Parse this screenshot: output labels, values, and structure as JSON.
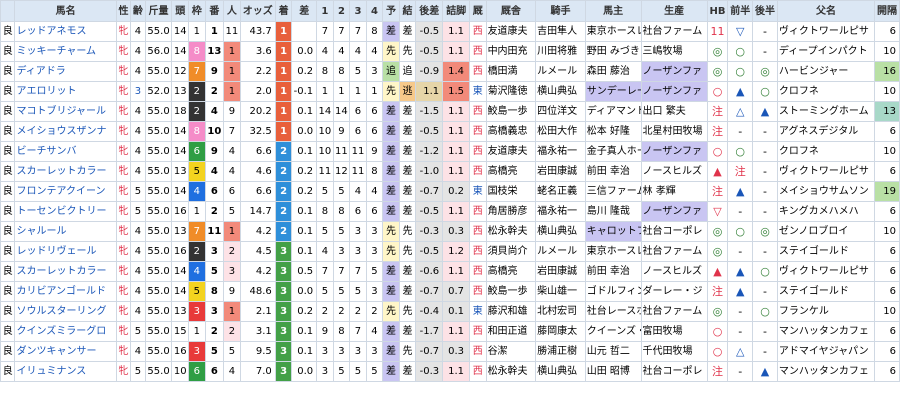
{
  "headers": [
    "",
    "馬名",
    "性",
    "齢",
    "斤量",
    "頭",
    "枠",
    "番",
    "人",
    "オッズ",
    "着",
    "差",
    "1",
    "2",
    "3",
    "4",
    "予",
    "結",
    "後差",
    "詰脚",
    "厩",
    "厩舎",
    "騎手",
    "馬主",
    "生産",
    "HB",
    "前半",
    "後半",
    "父名",
    "開隔"
  ],
  "rows": [
    [
      "良",
      "レッドアネモス",
      "牝",
      "4",
      "55.0",
      "14",
      "1",
      "1",
      "11",
      "43.7",
      "1",
      "",
      "7",
      "7",
      "7",
      "8",
      "差",
      "差",
      "-0.5",
      "1.1",
      "西",
      "友道康夫",
      "吉田隼人",
      "東京ホースレ",
      "社台ファーム",
      "11",
      "▽",
      "-",
      "ヴィクトワールピサ",
      "6"
    ],
    [
      "良",
      "ミッキーチャーム",
      "牝",
      "4",
      "56.0",
      "14",
      "8",
      "13",
      "1",
      "3.6",
      "1",
      "0.0",
      "4",
      "4",
      "4",
      "4",
      "先",
      "先",
      "-0.5",
      "1.1",
      "西",
      "中内田充",
      "川田将雅",
      "野田 みづき",
      "三嶋牧場",
      "◎",
      "○",
      "-",
      "ディープインパクト",
      "10"
    ],
    [
      "良",
      "ディアドラ",
      "牝",
      "4",
      "55.0",
      "12",
      "7",
      "9",
      "1",
      "2.2",
      "1",
      "0.2",
      "8",
      "8",
      "5",
      "3",
      "追",
      "追",
      "-0.9",
      "1.4",
      "西",
      "橋田満",
      "ルメール",
      "森田 藤治",
      "ノーザンファ",
      "◎",
      "○",
      "◎",
      "ハービンジャー",
      "16"
    ],
    [
      "良",
      "アエロリット",
      "牝",
      "3",
      "52.0",
      "13",
      "2",
      "2",
      "1",
      "2.0",
      "1",
      "-0.1",
      "1",
      "1",
      "1",
      "1",
      "先",
      "逃",
      "1.1",
      "1.5",
      "東",
      "菊沢隆徳",
      "横山典弘",
      "サンデーレー",
      "ノーザンファ",
      "○",
      "▲",
      "○",
      "クロフネ",
      "10"
    ],
    [
      "良",
      "マコトブリジャール",
      "牝",
      "4",
      "55.0",
      "18",
      "2",
      "4",
      "9",
      "20.2",
      "1",
      "0.1",
      "14",
      "14",
      "6",
      "6",
      "差",
      "差",
      "-1.5",
      "1.1",
      "西",
      "鮫島一歩",
      "四位洋文",
      "ディアマント",
      "出口 繁夫",
      "注",
      "△",
      "▲",
      "ストーミングホーム",
      "13"
    ],
    [
      "良",
      "メイショウスザンナ",
      "牝",
      "4",
      "55.0",
      "14",
      "8",
      "10",
      "7",
      "32.5",
      "1",
      "0.0",
      "10",
      "9",
      "6",
      "6",
      "差",
      "差",
      "-0.5",
      "1.1",
      "西",
      "高橋義忠",
      "松田大作",
      "松本 好隆",
      "北星村田牧場",
      "注",
      "-",
      "-",
      "アグネスデジタル",
      "6"
    ],
    [
      "良",
      "ビーチサンバ",
      "牝",
      "4",
      "55.0",
      "14",
      "6",
      "9",
      "4",
      "6.6",
      "2",
      "0.1",
      "10",
      "11",
      "11",
      "9",
      "差",
      "差",
      "-1.2",
      "1.1",
      "西",
      "友道康夫",
      "福永祐一",
      "金子真人ホー",
      "ノーザンファ",
      "○",
      "○",
      "-",
      "クロフネ",
      "10"
    ],
    [
      "良",
      "スカーレットカラー",
      "牝",
      "4",
      "55.0",
      "13",
      "5",
      "4",
      "4",
      "4.6",
      "2",
      "0.2",
      "11",
      "12",
      "11",
      "8",
      "差",
      "差",
      "-1.0",
      "1.1",
      "西",
      "高橋亮",
      "岩田康誠",
      "前田 幸治",
      "ノースヒルズ",
      "▲",
      "注",
      "-",
      "ヴィクトワールピサ",
      "6"
    ],
    [
      "良",
      "フロンテアクイーン",
      "牝",
      "5",
      "55.0",
      "14",
      "4",
      "6",
      "6",
      "6.6",
      "2",
      "0.2",
      "5",
      "5",
      "4",
      "4",
      "差",
      "差",
      "-0.7",
      "0.2",
      "東",
      "国枝栄",
      "蛯名正義",
      "三信ファーム",
      "林 孝輝",
      "注",
      "▲",
      "-",
      "メイショウサムソン",
      "19"
    ],
    [
      "良",
      "トーセンビクトリー",
      "牝",
      "5",
      "55.0",
      "16",
      "1",
      "2",
      "5",
      "14.7",
      "2",
      "0.1",
      "8",
      "8",
      "6",
      "6",
      "差",
      "差",
      "-0.5",
      "1.1",
      "西",
      "角居勝彦",
      "福永祐一",
      "島川 隆哉",
      "ノーザンファ",
      "▽",
      "-",
      "-",
      "キングカメハメハ",
      "6"
    ],
    [
      "良",
      "シャルール",
      "牝",
      "4",
      "55.0",
      "13",
      "7",
      "11",
      "1",
      "4.2",
      "2",
      "0.1",
      "5",
      "5",
      "3",
      "3",
      "先",
      "先",
      "-0.3",
      "0.3",
      "西",
      "松永幹夫",
      "横山典弘",
      "キャロットフ",
      "社台コーポレ",
      "◎",
      "○",
      "◎",
      "ゼンノロブロイ",
      "10"
    ],
    [
      "良",
      "レッドリヴェール",
      "牝",
      "4",
      "55.0",
      "16",
      "2",
      "3",
      "2",
      "4.5",
      "3",
      "0.1",
      "4",
      "3",
      "3",
      "3",
      "先",
      "先",
      "-0.5",
      "1.2",
      "西",
      "須貝尚介",
      "ルメール",
      "東京ホースレ",
      "社台ファーム",
      "◎",
      "-",
      "-",
      "ステイゴールド",
      "6"
    ],
    [
      "良",
      "スカーレットカラー",
      "牝",
      "4",
      "55.0",
      "14",
      "4",
      "5",
      "3",
      "4.2",
      "3",
      "0.5",
      "7",
      "7",
      "7",
      "5",
      "差",
      "差",
      "-0.6",
      "1.1",
      "西",
      "高橋亮",
      "岩田康誠",
      "前田 幸治",
      "ノースヒルズ",
      "▲",
      "▲",
      "○",
      "ヴィクトワールピサ",
      "6"
    ],
    [
      "良",
      "カリビアンゴールド",
      "牝",
      "4",
      "55.0",
      "14",
      "5",
      "8",
      "9",
      "48.6",
      "3",
      "0.0",
      "5",
      "5",
      "5",
      "3",
      "差",
      "差",
      "-0.7",
      "0.7",
      "西",
      "鮫島一歩",
      "柴山雄一",
      "ゴドルフィン",
      "ダーレー・ジ",
      "注",
      "▲",
      "-",
      "ステイゴールド",
      "6"
    ],
    [
      "良",
      "ソウルスターリング",
      "牝",
      "4",
      "55.0",
      "13",
      "3",
      "3",
      "1",
      "2.1",
      "3",
      "0.2",
      "2",
      "2",
      "2",
      "2",
      "先",
      "先",
      "-0.4",
      "0.1",
      "東",
      "藤沢和雄",
      "北村宏司",
      "社台レースホ",
      "社台ファーム",
      "◎",
      "-",
      "○",
      "フランケル",
      "10"
    ],
    [
      "良",
      "クインズミラーグロ",
      "牝",
      "5",
      "55.0",
      "15",
      "1",
      "2",
      "2",
      "3.1",
      "3",
      "0.1",
      "9",
      "8",
      "7",
      "4",
      "差",
      "差",
      "-1.7",
      "1.1",
      "西",
      "和田正道",
      "藤岡康太",
      "クイーンズ・",
      "富田牧場",
      "○",
      "-",
      "-",
      "マンハッタンカフェ",
      "6"
    ],
    [
      "良",
      "ダンツキャンサー",
      "牝",
      "4",
      "55.0",
      "16",
      "3",
      "5",
      "5",
      "9.5",
      "3",
      "0.1",
      "3",
      "3",
      "3",
      "3",
      "差",
      "先",
      "-0.7",
      "0.3",
      "西",
      "谷潔",
      "勝浦正樹",
      "山元 哲二",
      "千代田牧場",
      "○",
      "△",
      "-",
      "アドマイヤジャパン",
      "6"
    ],
    [
      "良",
      "イリュミナンス",
      "牝",
      "5",
      "55.0",
      "10",
      "6",
      "6",
      "4",
      "7.0",
      "3",
      "0.0",
      "3",
      "5",
      "5",
      "5",
      "差",
      "差",
      "-0.3",
      "1.1",
      "西",
      "松永幹夫",
      "横山典弘",
      "山田 昭博",
      "社台コーポレ",
      "注",
      "-",
      "▲",
      "マンハッタンカフェ",
      "6"
    ]
  ]
}
